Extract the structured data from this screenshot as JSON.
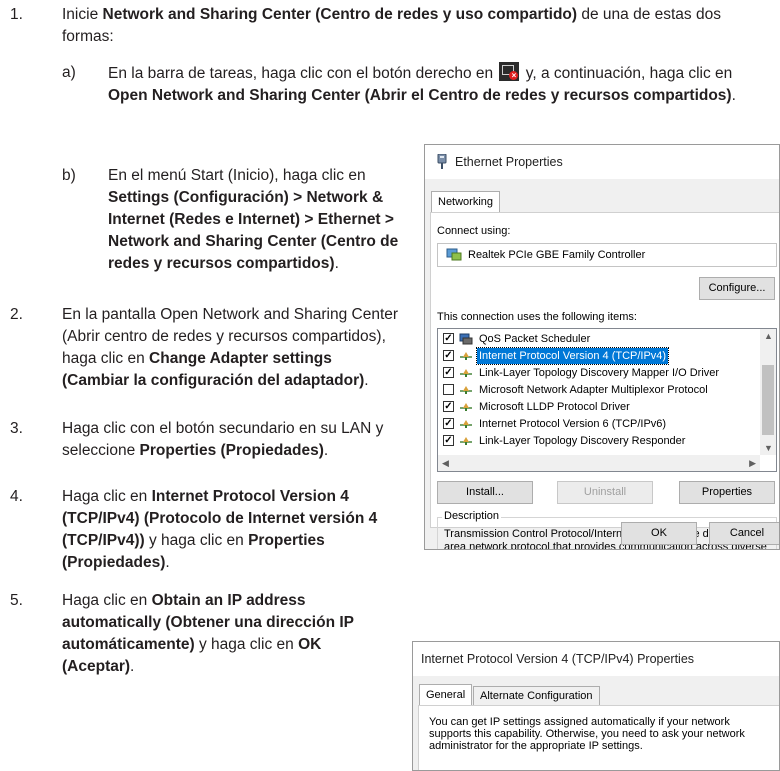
{
  "steps": [
    {
      "num": "1.",
      "intro": [
        {
          "t": "Inicie ",
          "b": false
        },
        {
          "t": "Network and Sharing Center (Centro de redes y uso compartido)",
          "b": true
        },
        {
          "t": " de una de estas dos formas:",
          "b": false
        }
      ],
      "substeps": [
        {
          "letter": "a)",
          "before": "En la barra de tareas, haga clic con el botón derecho en",
          "after": " y, a continuación, haga clic en ",
          "bold": "Open Network and Sharing Center (Abrir el Centro de redes y recursos compartidos)",
          "end": "."
        },
        {
          "letter": "b)",
          "before": "En el menú Start (Inicio), haga clic en ",
          "bold": "Settings (Configuración) > Network & Internet (Redes e Internet) > Ethernet > Network and Sharing Center (Centro de redes y recursos compartidos)",
          "end": "."
        }
      ]
    },
    {
      "num": "2.",
      "before": "En la pantalla Open Network and Sharing Center (Abrir centro de redes y recursos compartidos), haga clic en ",
      "bold": "Change Adapter settings (Cambiar la configuración del adaptador)",
      "end": "."
    },
    {
      "num": "3.",
      "before": "Haga clic con el botón secundario en su LAN y seleccione ",
      "bold": "Properties (Propiedades)",
      "end": "."
    },
    {
      "num": "4.",
      "before": "Haga clic en ",
      "bold": "Internet Protocol Version 4 (TCP/IPv4) (Protocolo de Internet versión 4 (TCP/IPv4))",
      "mid": " y haga clic en ",
      "bold2": "Properties (Propiedades)",
      "end": "."
    },
    {
      "num": "5.",
      "before": "Haga clic en ",
      "bold": "Obtain an IP address automatically (Obtener una dirección IP automáticamente)",
      "mid": " y haga clic en ",
      "bold2": "OK (Aceptar)",
      "end": "."
    }
  ],
  "ethernet_dialog": {
    "title": "Ethernet Properties",
    "tab": "Networking",
    "connect_using_label": "Connect using:",
    "adapter": "Realtek PCIe GBE Family Controller",
    "configure_button": "Configure...",
    "items_label": "This connection uses the following items:",
    "items": [
      {
        "label": "QoS Packet Scheduler",
        "checked": true,
        "selected": false,
        "icon": "qos-icon"
      },
      {
        "label": "Internet Protocol Version 4 (TCP/IPv4)",
        "checked": true,
        "selected": true,
        "icon": "protocol-icon"
      },
      {
        "label": "Link-Layer Topology Discovery Mapper I/O Driver",
        "checked": true,
        "selected": false,
        "icon": "protocol-icon"
      },
      {
        "label": "Microsoft Network Adapter Multiplexor Protocol",
        "checked": false,
        "selected": false,
        "icon": "protocol-icon"
      },
      {
        "label": "Microsoft LLDP Protocol Driver",
        "checked": true,
        "selected": false,
        "icon": "protocol-icon"
      },
      {
        "label": "Internet Protocol Version 6 (TCP/IPv6)",
        "checked": true,
        "selected": false,
        "icon": "protocol-icon"
      },
      {
        "label": "Link-Layer Topology Discovery Responder",
        "checked": true,
        "selected": false,
        "icon": "protocol-icon"
      }
    ],
    "install_button": "Install...",
    "uninstall_button": "Uninstall",
    "properties_button": "Properties",
    "description_label": "Description",
    "description_text": "Transmission Control Protocol/Internet Protocol. The default wide area network protocol that provides communication across diverse interconnected networks.",
    "ok_button": "OK",
    "cancel_button": "Cancel"
  },
  "ipv4_dialog": {
    "title": "Internet Protocol Version 4 (TCP/IPv4) Properties",
    "tabs": [
      "General",
      "Alternate Configuration"
    ],
    "text": "You can get IP settings assigned automatically if your network supports this capability. Otherwise, you need to ask your network administrator for the appropriate IP settings."
  },
  "colors": {
    "text": "#231f20",
    "selection": "#0078d7",
    "dialog_bg": "#f0f0f0"
  }
}
